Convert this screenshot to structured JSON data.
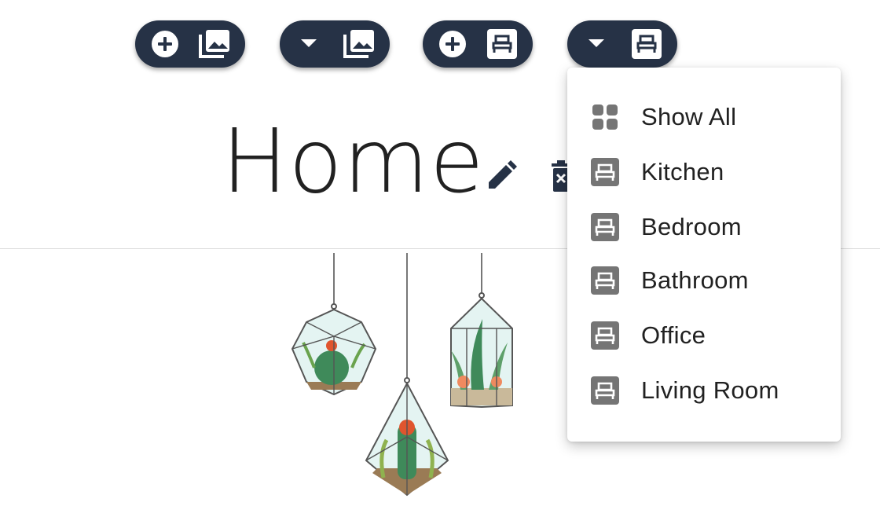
{
  "toolbar": {
    "buttons": [
      {
        "left_icon": "add-circle-icon",
        "right_icon": "image-gallery-icon"
      },
      {
        "left_icon": "dropdown-arrow-icon",
        "right_icon": "image-gallery-icon"
      },
      {
        "left_icon": "add-circle-icon",
        "right_icon": "room-bed-icon"
      },
      {
        "left_icon": "dropdown-arrow-icon",
        "right_icon": "room-bed-icon"
      }
    ],
    "color": "#263246"
  },
  "page": {
    "title": "Home",
    "edit_icon": "pencil-icon",
    "delete_icon": "trash-icon"
  },
  "room_menu": {
    "items": [
      {
        "label": "Show All",
        "icon": "grid-icon"
      },
      {
        "label": "Kitchen",
        "icon": "room-bed-icon"
      },
      {
        "label": "Bedroom",
        "icon": "room-bed-icon"
      },
      {
        "label": "Bathroom",
        "icon": "room-bed-icon"
      },
      {
        "label": "Office",
        "icon": "room-bed-icon"
      },
      {
        "label": "Living Room",
        "icon": "room-bed-icon"
      }
    ],
    "icon_color": "#757575"
  }
}
